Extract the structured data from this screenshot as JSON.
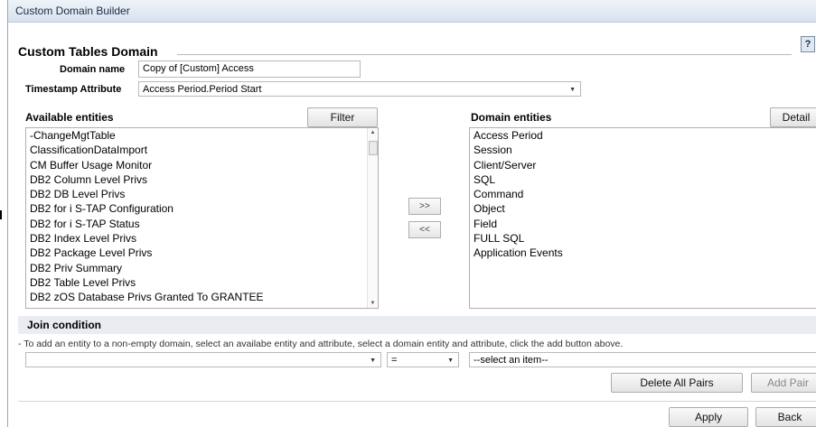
{
  "window": {
    "title": "Custom Domain Builder"
  },
  "section": {
    "title": "Custom Tables Domain",
    "help_label": "?"
  },
  "form": {
    "domain_name_label": "Domain name",
    "domain_name_value": "Copy of [Custom] Access",
    "timestamp_label": "Timestamp Attribute",
    "timestamp_value": "Access Period.Period Start"
  },
  "available": {
    "label": "Available entities",
    "filter_button": "Filter",
    "items": [
      "-ChangeMgtTable",
      "ClassificationDataImport",
      "CM Buffer Usage Monitor",
      "DB2 Column Level Privs",
      "DB2 DB Level Privs",
      "DB2 for i S-TAP Configuration",
      "DB2 for i S-TAP Status",
      "DB2 Index Level Privs",
      "DB2 Package Level Privs",
      "DB2 Priv Summary",
      "DB2 Table Level Privs",
      "DB2 zOS Database Privs Granted To GRANTEE"
    ]
  },
  "domain": {
    "label": "Domain entities",
    "detail_button": "Detail",
    "items": [
      "Access Period",
      "Session",
      "Client/Server",
      "SQL",
      "Command",
      "Object",
      "Field",
      "FULL SQL",
      "Application Events"
    ]
  },
  "move": {
    "add_label": ">>",
    "remove_label": "<<"
  },
  "join": {
    "title": "Join condition",
    "hint": "- To add an entity to a non-empty domain, select an availabe entity and attribute, select a domain entity and attribute, click the add button above.",
    "left_value": "",
    "operator": "=",
    "right_placeholder": "--select an item--",
    "delete_all_label": "Delete All Pairs",
    "add_pair_label": "Add Pair"
  },
  "footer": {
    "apply_label": "Apply",
    "back_label": "Back"
  }
}
